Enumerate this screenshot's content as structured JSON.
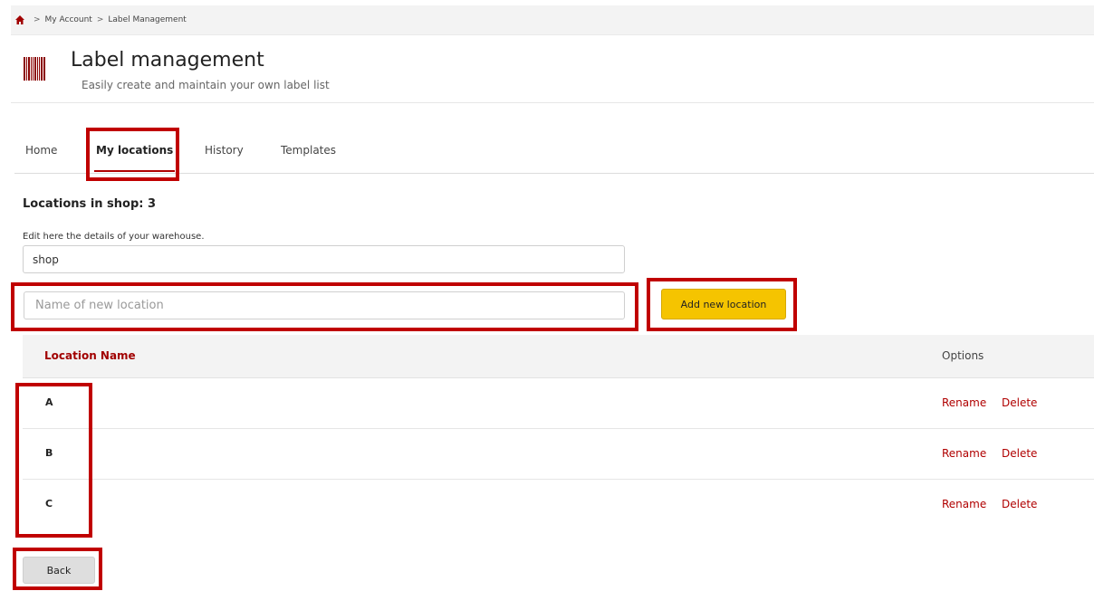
{
  "breadcrumb": {
    "items": [
      "My Account",
      "Label Management"
    ]
  },
  "header": {
    "title": "Label management",
    "subtitle": "Easily create and maintain your own label list"
  },
  "tabs": [
    {
      "label": "Home"
    },
    {
      "label": "My locations",
      "active": true
    },
    {
      "label": "History"
    },
    {
      "label": "Templates"
    }
  ],
  "locations": {
    "count_title": "Locations in shop: 3",
    "edit_label": "Edit here the details of your warehouse.",
    "warehouse_value": "shop",
    "new_location_placeholder": "Name of new location",
    "add_button_label": "Add new location"
  },
  "table": {
    "headers": {
      "name": "Location Name",
      "options": "Options"
    },
    "rows": [
      {
        "name": "A",
        "rename": "Rename",
        "delete": "Delete"
      },
      {
        "name": "B",
        "rename": "Rename",
        "delete": "Delete"
      },
      {
        "name": "C",
        "rename": "Rename",
        "delete": "Delete"
      }
    ]
  },
  "back_button_label": "Back",
  "colors": {
    "accent": "#b00000",
    "highlight": "#c00000",
    "button_yellow": "#f5c400"
  },
  "icons": {
    "home": "home-icon",
    "barcode": "barcode-icon"
  }
}
